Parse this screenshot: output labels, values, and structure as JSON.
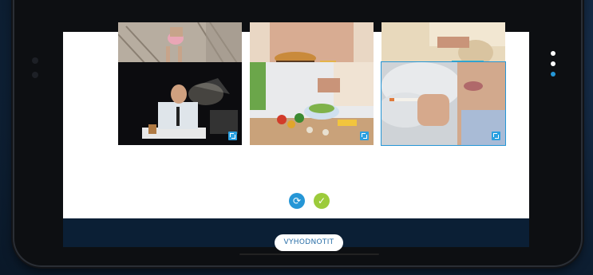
{
  "images": [
    {
      "name": "image-stairs-walker",
      "selected": false
    },
    {
      "name": "image-burger-eater",
      "selected": false
    },
    {
      "name": "image-beach-sleeper",
      "selected": false
    },
    {
      "name": "image-night-worker",
      "selected": false
    },
    {
      "name": "image-cooking-vegetables",
      "selected": false
    },
    {
      "name": "image-smoker",
      "selected": true
    }
  ],
  "controls": {
    "reset_icon": "refresh-icon",
    "confirm_icon": "check-icon",
    "evaluate_label": "VYHODNOTIT"
  },
  "pagination": {
    "total": 3,
    "current": 3
  },
  "colors": {
    "accent": "#2596d6",
    "confirm": "#9ccb3b",
    "button_text": "#2a6fa8"
  }
}
